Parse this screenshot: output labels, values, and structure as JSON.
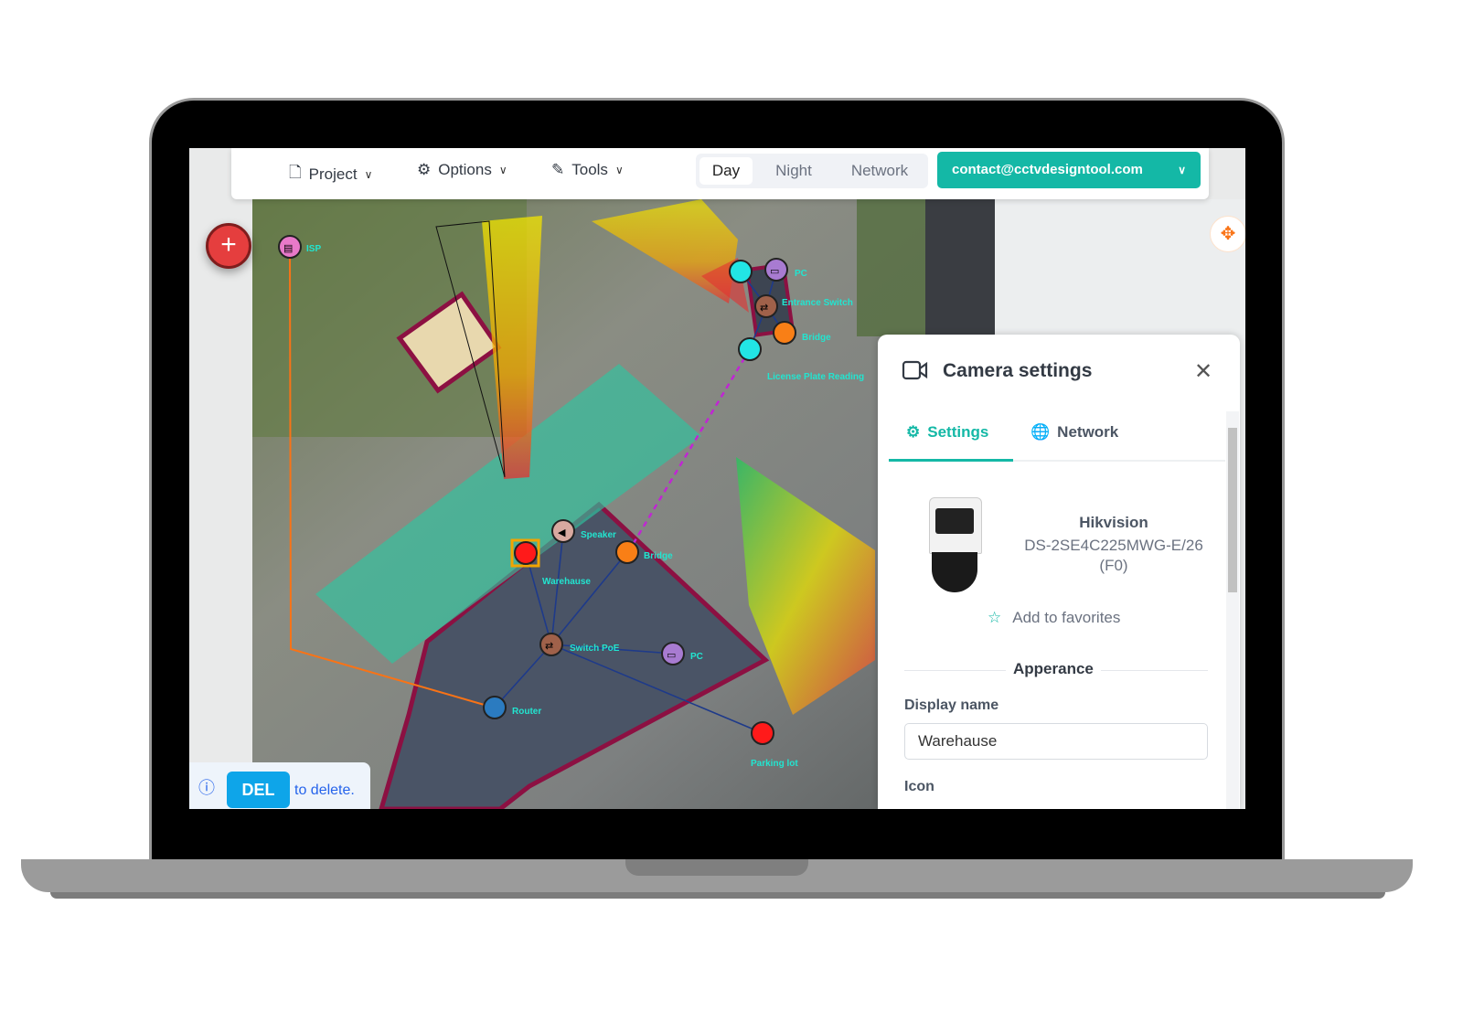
{
  "toolbar": {
    "menus": [
      {
        "label": "Project",
        "icon": "file-icon"
      },
      {
        "label": "Options",
        "icon": "gear-icon"
      },
      {
        "label": "Tools",
        "icon": "pencil-icon"
      }
    ],
    "view_modes": [
      {
        "label": "Day",
        "active": true
      },
      {
        "label": "Night",
        "active": false
      },
      {
        "label": "Network",
        "active": false
      }
    ],
    "account": "contact@cctvdesigntool.com"
  },
  "map": {
    "devices": [
      {
        "label": "ISP",
        "type": "isp",
        "color": "#e879c9"
      },
      {
        "label": "PC",
        "type": "pc",
        "color": "#a87bd1"
      },
      {
        "label": "Entrance Switch",
        "type": "switch",
        "color": "#a0614a"
      },
      {
        "label": "Bridge",
        "type": "wifi",
        "color": "#f97f16"
      },
      {
        "label": "License Plate Reading",
        "type": "camera",
        "color": "#22e5e5"
      },
      {
        "label": "Speaker",
        "type": "speaker",
        "color": "#d9a9a0"
      },
      {
        "label": "Bridge",
        "type": "wifi",
        "color": "#f97f16"
      },
      {
        "label": "Warehause",
        "type": "ptz-camera",
        "color": "#ff1a1a"
      },
      {
        "label": "Switch PoE",
        "type": "switch",
        "color": "#a0614a"
      },
      {
        "label": "PC",
        "type": "pc",
        "color": "#a87bd1"
      },
      {
        "label": "Router",
        "type": "router",
        "color": "#2b7bc0"
      },
      {
        "label": "Parking lot",
        "type": "ptz-camera",
        "color": "#ff1a1a"
      }
    ]
  },
  "hint": {
    "key": "DEL",
    "text": "to delete."
  },
  "panel": {
    "title": "Camera settings",
    "tabs": [
      {
        "label": "Settings",
        "active": true
      },
      {
        "label": "Network",
        "active": false
      }
    ],
    "brand": "Hikvision",
    "model": "DS-2SE4C225MWG-E/26(F0)",
    "favorites": "Add to favorites",
    "section": "Apperance",
    "display_name_label": "Display name",
    "display_name_value": "Warehause",
    "icon_label": "Icon"
  },
  "colors": {
    "accent": "#14b8a6",
    "add": "#e53e3e",
    "del": "#0ea5e9"
  }
}
